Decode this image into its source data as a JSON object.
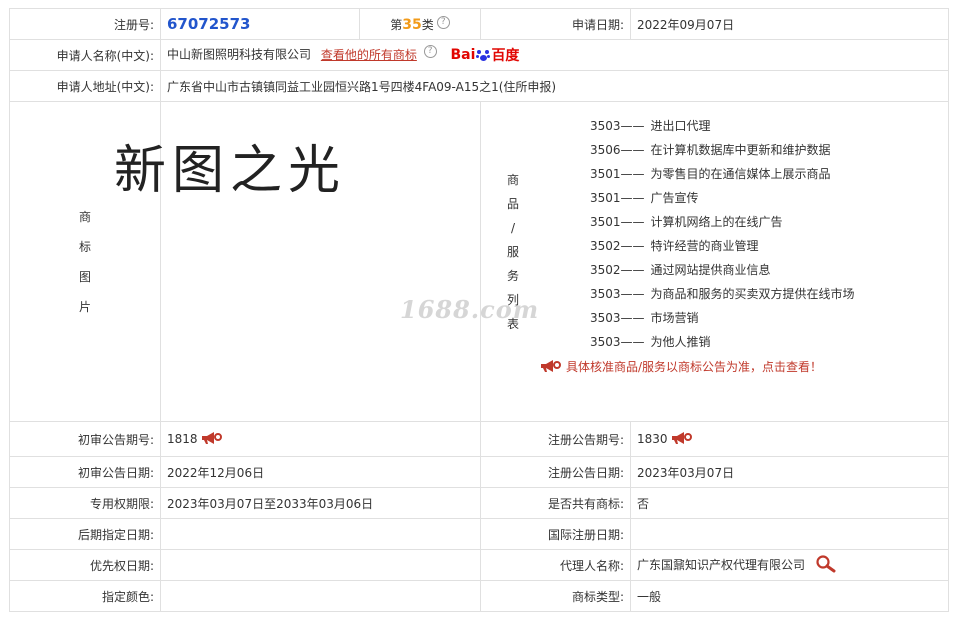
{
  "header": {
    "reg_no_label": "注册号:",
    "reg_no": "67072573",
    "class_prefix": "第",
    "class_num": "35",
    "class_suffix": "类",
    "apply_date_label": "申请日期:",
    "apply_date": "2022年09月07日"
  },
  "applicant": {
    "name_label": "申请人名称(中文):",
    "name": "中山新图照明科技有限公司",
    "all_marks_link": "查看他的所有商标",
    "baidu_bai": "Bai",
    "baidu_du": "百度",
    "address_label": "申请人地址(中文):",
    "address": "广东省中山市古镇镇同益工业园恒兴路1号四楼4FA09-A15之1(住所申报)"
  },
  "image_section": {
    "label_chars": [
      "商",
      "标",
      "图",
      "片"
    ],
    "trademark_text": "新图之光",
    "watermark": "1688.com"
  },
  "goods_section": {
    "label_chars": [
      "商",
      "品",
      "/",
      "服",
      "务",
      "列",
      "表"
    ],
    "items": [
      {
        "code": "3503——",
        "name": "进出口代理"
      },
      {
        "code": "3506——",
        "name": "在计算机数据库中更新和维护数据"
      },
      {
        "code": "3501——",
        "name": "为零售目的在通信媒体上展示商品"
      },
      {
        "code": "3501——",
        "name": "广告宣传"
      },
      {
        "code": "3501——",
        "name": "计算机网络上的在线广告"
      },
      {
        "code": "3502——",
        "name": "特许经营的商业管理"
      },
      {
        "code": "3502——",
        "name": "通过网站提供商业信息"
      },
      {
        "code": "3503——",
        "name": "为商品和服务的买卖双方提供在线市场"
      },
      {
        "code": "3503——",
        "name": "市场营销"
      },
      {
        "code": "3503——",
        "name": "为他人推销"
      }
    ],
    "notice": "具体核准商品/服务以商标公告为准，点击查看！"
  },
  "rows": {
    "prelim_no_label": "初审公告期号:",
    "prelim_no": "1818",
    "reg_pub_no_label": "注册公告期号:",
    "reg_pub_no": "1830",
    "prelim_date_label": "初审公告日期:",
    "prelim_date": "2022年12月06日",
    "reg_pub_date_label": "注册公告日期:",
    "reg_pub_date": "2023年03月07日",
    "exclusive_label": "专用权期限:",
    "exclusive": "2023年03月07日至2033年03月06日",
    "shared_label": "是否共有商标:",
    "shared": "否",
    "later_label": "后期指定日期:",
    "later": "",
    "intl_label": "国际注册日期:",
    "intl": "",
    "priority_label": "优先权日期:",
    "priority": "",
    "agent_label": "代理人名称:",
    "agent": "广东国鼐知识产权代理有限公司",
    "color_label": "指定颜色:",
    "color": "",
    "type_label": "商标类型:",
    "type": "一般"
  },
  "colors": {
    "accent_blue": "#2255cc",
    "class_orange": "#f29b1a",
    "link_red": "#c0392b"
  }
}
